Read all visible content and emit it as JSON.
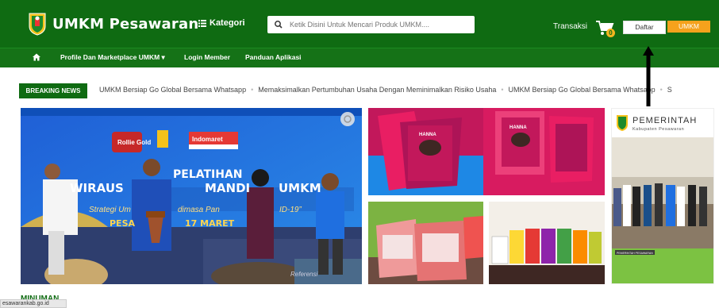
{
  "header": {
    "brand": "UMKM Pesawaran",
    "kategori_label": "Kategori",
    "search_placeholder": "Ketik Disini Untuk Mencari Produk UMKM....",
    "transaksi_label": "Transaksi",
    "cart_count": "0",
    "daftar_label": "Daftar",
    "umkm_label": "UMKM"
  },
  "nav": {
    "items": [
      {
        "label": "Profile Dan Marketplace UMKM ▾"
      },
      {
        "label": "Login Member"
      },
      {
        "label": "Panduan Aplikasi"
      }
    ]
  },
  "breaking": {
    "label": "BREAKING NEWS",
    "items": [
      "UMKM Bersiap Go Global Bersama Whatsapp",
      "Memaksimalkan Pertumbuhan Usaha Dengan Meminimalkan Risiko Usaha",
      "UMKM Bersiap Go Global Bersama Whatsapp",
      "S"
    ]
  },
  "banner": {
    "sponsor1": "Rollie Gold",
    "sponsor2": "Indomaret",
    "title_line1": "PELATIHAN",
    "title_line2": "WIRAUS",
    "title_line2b": "MANDI",
    "title_line2c": "UMKM",
    "subtitle": "Strategi Um",
    "subtitle2": "dimasa Pan",
    "subtitle3": "ID-19”",
    "date_left": "PESA",
    "date_right": "17 MARET",
    "watermark": "Referensi"
  },
  "products": {
    "product_label1": "HANNA",
    "product_label2": "HANNA"
  },
  "pemerintah": {
    "title": "PEMERINTAH",
    "subtitle": "Kabupaten Pesawaran",
    "caption": "PEMERINTAH PESAWARAN"
  },
  "section": {
    "minuman": "MINUMAN"
  },
  "status": {
    "url": "esawarankab.go.id"
  },
  "colors": {
    "primary_green": "#0f6b12",
    "nav_green": "#157217",
    "accent_orange": "#f5a21c",
    "badge_yellow": "#f3b61f"
  }
}
